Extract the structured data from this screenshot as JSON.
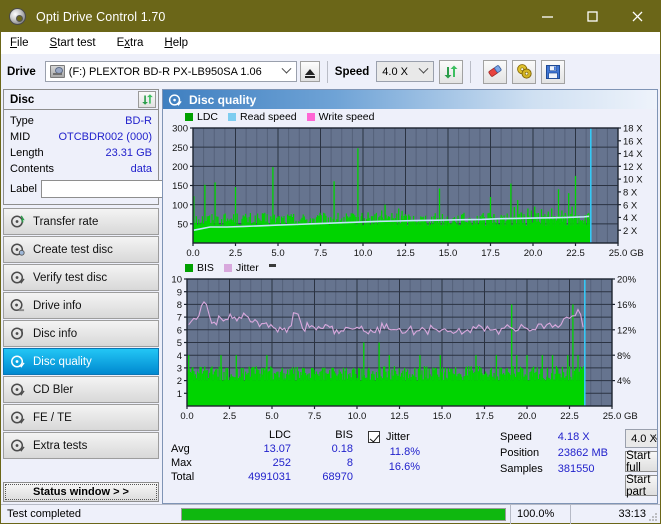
{
  "window": {
    "title": "Opti Drive Control 1.70",
    "icon": "disc-icon",
    "minimize": "minimize-icon",
    "maximize": "maximize-icon",
    "close": "close-icon"
  },
  "menu": {
    "items": [
      {
        "label": "File",
        "mnemonic": "F"
      },
      {
        "label": "Start test",
        "mnemonic": "S"
      },
      {
        "label": "Extra",
        "mnemonic": "x"
      },
      {
        "label": "Help",
        "mnemonic": "H"
      }
    ]
  },
  "toolbar": {
    "drive_label": "Drive",
    "drive_value": "(F:)   PLEXTOR BD-R  PX-LB950SA 1.06",
    "eject": "eject-icon",
    "speed_label": "Speed",
    "speed_value": "4.0 X",
    "refresh": "refresh-icon",
    "erase": "eraser-icon",
    "tools": "discs-icon",
    "save": "save-icon"
  },
  "disc": {
    "title": "Disc",
    "refresh": "refresh-icon",
    "rows": [
      {
        "key": "Type",
        "value": "BD-R"
      },
      {
        "key": "MID",
        "value": "OTCBDR002 (000)"
      },
      {
        "key": "Length",
        "value": "23.31 GB"
      },
      {
        "key": "Contents",
        "value": "data"
      }
    ],
    "label_key": "Label",
    "label_value": "",
    "label_button": "disc-label-icon"
  },
  "sidebar": {
    "items": [
      {
        "label": "Transfer rate",
        "active": false
      },
      {
        "label": "Create test disc",
        "active": false
      },
      {
        "label": "Verify test disc",
        "active": false
      },
      {
        "label": "Drive info",
        "active": false
      },
      {
        "label": "Disc info",
        "active": false
      },
      {
        "label": "Disc quality",
        "active": true
      },
      {
        "label": "CD Bler",
        "active": false
      },
      {
        "label": "FE / TE",
        "active": false
      },
      {
        "label": "Extra tests",
        "active": false
      }
    ],
    "status_button": "Status window > >"
  },
  "main": {
    "title": "Disc quality",
    "icon": "disc-quality-icon"
  },
  "chart_data": [
    {
      "type": "line",
      "id": "ldc-chart",
      "title": "",
      "xlabel": "GB",
      "ylabel": "",
      "legend": [
        {
          "name": "LDC",
          "color": "#00a000"
        },
        {
          "name": "Read speed",
          "color": "#7ecdf0"
        },
        {
          "name": "Write speed",
          "color": "#ff66d4"
        }
      ],
      "legend_position": "top-left",
      "grid": true,
      "xlim": [
        0.0,
        25.0
      ],
      "xticks": [
        "0.0",
        "2.5",
        "5.0",
        "7.5",
        "10.0",
        "12.5",
        "15.0",
        "17.5",
        "20.0",
        "22.5",
        "25.0"
      ],
      "xunit": "GB",
      "ylim": [
        0,
        300
      ],
      "yticks": [
        "50",
        "100",
        "150",
        "200",
        "250",
        "300"
      ],
      "y2label": "X",
      "y2lim": [
        0,
        18
      ],
      "y2ticks": [
        "2 X",
        "4 X",
        "6 X",
        "8 X",
        "10 X",
        "12 X",
        "14 X",
        "16 X",
        "18 X"
      ],
      "data_end_gb": 23.4,
      "series": [
        {
          "name": "LDC",
          "color": "#00cc00",
          "type": "bar",
          "baseline_band": 45,
          "x": [
            0.05,
            0.2,
            0.35,
            0.5,
            0.7,
            0.85,
            1.0,
            1.15,
            1.3,
            1.5,
            1.7,
            1.9,
            2.1,
            2.3,
            2.5,
            2.7,
            2.9,
            3.1,
            3.3,
            3.5,
            3.7,
            3.9,
            4.1,
            4.3,
            4.5,
            4.7,
            4.9,
            5.1,
            5.3,
            5.5,
            5.7,
            5.9,
            6.1,
            6.3,
            6.5,
            6.7,
            6.9,
            7.1,
            7.3,
            7.5,
            7.7,
            7.9,
            8.1,
            8.3,
            8.5,
            8.7,
            8.9,
            9.1,
            9.3,
            9.5,
            9.7,
            9.9,
            10.1,
            10.3,
            10.5,
            10.7,
            10.9,
            11.1,
            11.3,
            11.5,
            11.7,
            11.9,
            12.1,
            12.3,
            12.5,
            12.7,
            12.9,
            13.1,
            13.3,
            13.5,
            13.7,
            13.9,
            14.1,
            14.3,
            14.5,
            14.7,
            14.9,
            15.1,
            15.3,
            15.5,
            15.7,
            15.9,
            16.1,
            16.3,
            16.5,
            16.7,
            16.9,
            17.1,
            17.3,
            17.5,
            17.7,
            17.9,
            18.1,
            18.3,
            18.5,
            18.7,
            18.9,
            19.1,
            19.3,
            19.5,
            19.7,
            19.9,
            20.1,
            20.3,
            20.5,
            20.7,
            20.9,
            21.1,
            21.3,
            21.5,
            21.7,
            21.9,
            22.1,
            22.3,
            22.5,
            22.7,
            22.9,
            23.1,
            23.3
          ],
          "y": [
            122,
            70,
            50,
            44,
            152,
            60,
            45,
            40,
            158,
            50,
            42,
            44,
            38,
            60,
            146,
            48,
            40,
            45,
            42,
            40,
            50,
            38,
            42,
            46,
            40,
            198,
            55,
            48,
            45,
            40,
            42,
            48,
            50,
            44,
            42,
            40,
            55,
            48,
            44,
            42,
            46,
            50,
            44,
            161,
            48,
            46,
            50,
            55,
            60,
            48,
            247,
            70,
            55,
            80,
            70,
            75,
            60,
            85,
            100,
            70,
            78,
            65,
            90,
            84,
            62,
            70,
            58,
            55,
            60,
            52,
            48,
            56,
            50,
            58,
            142,
            55,
            48,
            52,
            58,
            50,
            46,
            60,
            54,
            50,
            58,
            62,
            70,
            55,
            60,
            120,
            75,
            62,
            68,
            72,
            60,
            155,
            94,
            112,
            80,
            70,
            90,
            85,
            95,
            78,
            88,
            75,
            82,
            90,
            70,
            140,
            85,
            78,
            130,
            95,
            175,
            72,
            60,
            55,
            50
          ]
        },
        {
          "name": "Read speed",
          "color": "#9ad7f2",
          "type": "line",
          "x": [
            0.05,
            1.0,
            2.0,
            3.0,
            4.0,
            5.0,
            6.0,
            7.0,
            8.0,
            9.0,
            10.0,
            11.0,
            12.0,
            13.0,
            14.0,
            15.0,
            16.0,
            17.0,
            18.0,
            19.0,
            20.0,
            21.0,
            22.0,
            23.0,
            23.3
          ],
          "y_speed_x": [
            2.0,
            2.5,
            2.5,
            2.6,
            2.7,
            2.8,
            2.9,
            3.0,
            3.1,
            3.2,
            3.3,
            3.4,
            3.45,
            3.5,
            3.55,
            3.6,
            3.65,
            3.7,
            3.8,
            3.85,
            3.9,
            3.95,
            4.0,
            4.1,
            4.18
          ]
        },
        {
          "name": "position-marker",
          "color": "#35c8f5",
          "type": "vline",
          "x": 23.4
        }
      ]
    },
    {
      "type": "line",
      "id": "bis-jitter-chart",
      "title": "",
      "xlabel": "GB",
      "legend": [
        {
          "name": "BIS",
          "color": "#00a000"
        },
        {
          "name": "Jitter",
          "color": "#d8a8dd"
        }
      ],
      "legend_position": "top-left",
      "grid": true,
      "xlim": [
        0.0,
        25.0
      ],
      "xticks": [
        "0.0",
        "2.5",
        "5.0",
        "7.5",
        "10.0",
        "12.5",
        "15.0",
        "17.5",
        "20.0",
        "22.5",
        "25.0"
      ],
      "xunit": "GB",
      "ylim": [
        0,
        10
      ],
      "yticks": [
        "1",
        "2",
        "3",
        "4",
        "5",
        "6",
        "7",
        "8",
        "9",
        "10"
      ],
      "y2lim": [
        0,
        20
      ],
      "y2ticks": [
        "4%",
        "8%",
        "12%",
        "16%",
        "20%"
      ],
      "data_end_gb": 23.4,
      "series": [
        {
          "name": "BIS",
          "color": "#00cc00",
          "type": "bar",
          "baseline_band": 2.0,
          "x": [
            0.1,
            0.3,
            0.5,
            0.8,
            1.1,
            1.4,
            1.7,
            2.0,
            2.3,
            2.6,
            2.9,
            3.2,
            3.5,
            3.8,
            4.1,
            4.4,
            4.7,
            5.0,
            5.3,
            5.6,
            5.9,
            6.2,
            6.5,
            6.8,
            7.1,
            7.4,
            7.7,
            8.0,
            8.3,
            8.6,
            8.9,
            9.2,
            9.5,
            9.8,
            10.1,
            10.4,
            10.7,
            11.0,
            11.3,
            11.6,
            11.9,
            12.2,
            12.5,
            12.8,
            13.1,
            13.4,
            13.7,
            14.0,
            14.3,
            14.6,
            14.9,
            15.2,
            15.5,
            15.8,
            16.1,
            16.4,
            16.7,
            17.0,
            17.3,
            17.6,
            17.9,
            18.2,
            18.5,
            18.8,
            19.1,
            19.4,
            19.7,
            20.0,
            20.3,
            20.6,
            20.9,
            21.2,
            21.5,
            21.8,
            22.1,
            22.4,
            22.7,
            23.0,
            23.3
          ],
          "y": [
            4,
            3,
            2.5,
            3,
            2.5,
            3,
            2.5,
            4,
            3,
            2.5,
            4,
            3,
            2.5,
            3,
            2.5,
            3,
            4,
            3,
            2.5,
            3,
            2.5,
            3,
            2.5,
            3,
            2.5,
            3,
            2.5,
            3,
            2.5,
            3,
            2.5,
            3,
            2.5,
            3,
            3,
            5,
            3,
            2.5,
            5,
            3,
            4,
            3,
            2.5,
            3,
            2.5,
            3,
            4,
            3,
            2.5,
            3,
            4,
            3,
            2.5,
            3,
            2.5,
            3,
            3,
            4,
            3,
            2.5,
            3,
            4,
            3,
            2.5,
            8,
            4,
            3,
            4,
            3,
            2.5,
            4,
            3,
            4,
            3,
            2.5,
            4,
            8,
            4,
            3
          ]
        },
        {
          "name": "Jitter",
          "color": "#d8a8dd",
          "type": "line",
          "unit": "%",
          "x": [
            0.1,
            0.4,
            0.7,
            1.0,
            1.3,
            1.6,
            2.0,
            2.4,
            2.8,
            3.2,
            3.6,
            4.0,
            4.4,
            4.8,
            5.2,
            5.6,
            6.0,
            6.4,
            6.8,
            7.2,
            7.6,
            8.0,
            8.4,
            8.8,
            9.2,
            9.6,
            10.0,
            10.4,
            10.8,
            11.2,
            11.6,
            12.0,
            12.5,
            13.0,
            13.5,
            14.0,
            14.5,
            15.0,
            15.5,
            16.0,
            16.5,
            17.0,
            17.5,
            18.0,
            18.5,
            19.0,
            19.5,
            20.0,
            20.5,
            21.0,
            21.5,
            22.0,
            22.5,
            23.0,
            23.3
          ],
          "y": [
            6.4,
            6.9,
            7.1,
            8.2,
            7.2,
            6.6,
            6.9,
            6.8,
            7.0,
            6.9,
            7.0,
            6.8,
            6.5,
            6.2,
            6.1,
            6.0,
            6.2,
            7.3,
            6.1,
            6.2,
            6.0,
            6.1,
            6.2,
            6.0,
            5.9,
            6.1,
            6.2,
            5.9,
            6.0,
            6.2,
            6.1,
            6.0,
            6.1,
            6.0,
            5.9,
            6.0,
            6.1,
            6.0,
            5.9,
            6.1,
            6.0,
            6.1,
            5.9,
            6.0,
            6.1,
            6.2,
            6.0,
            6.1,
            6.0,
            6.1,
            6.2,
            6.4,
            6.9,
            7.6,
            6.2
          ]
        },
        {
          "name": "position-marker",
          "color": "#35c8f5",
          "type": "vline",
          "x": 23.4
        }
      ]
    }
  ],
  "stats": {
    "col_headers": [
      "LDC",
      "BIS"
    ],
    "rows": [
      {
        "label": "Avg",
        "ldc": "13.07",
        "bis": "0.18"
      },
      {
        "label": "Max",
        "ldc": "252",
        "bis": "8"
      },
      {
        "label": "Total",
        "ldc": "4991031",
        "bis": "68970"
      }
    ],
    "jitter_label": "Jitter",
    "jitter_checked": true,
    "jitter_avg": "11.8%",
    "jitter_max": "16.6%",
    "speed_label": "Speed",
    "speed_value": "4.18 X",
    "position_label": "Position",
    "position_value": "23862 MB",
    "samples_label": "Samples",
    "samples_value": "381550",
    "speed_select": "4.0 X",
    "start_full": "Start full",
    "start_part": "Start part"
  },
  "statusbar": {
    "text": "Test completed",
    "progress_pct": 100.0,
    "progress_label": "100.0%",
    "elapsed": "33:13"
  },
  "colors": {
    "titlebar": "#6b6618",
    "accent": "#2222cc",
    "plot_bg": "#66748f",
    "ldc_green": "#00cc00",
    "read_speed": "#9ad7f2",
    "write_speed": "#ff66d4",
    "jitter": "#d8a8dd",
    "marker_cyan": "#35c8f5",
    "progress_green": "#0fb80f"
  }
}
